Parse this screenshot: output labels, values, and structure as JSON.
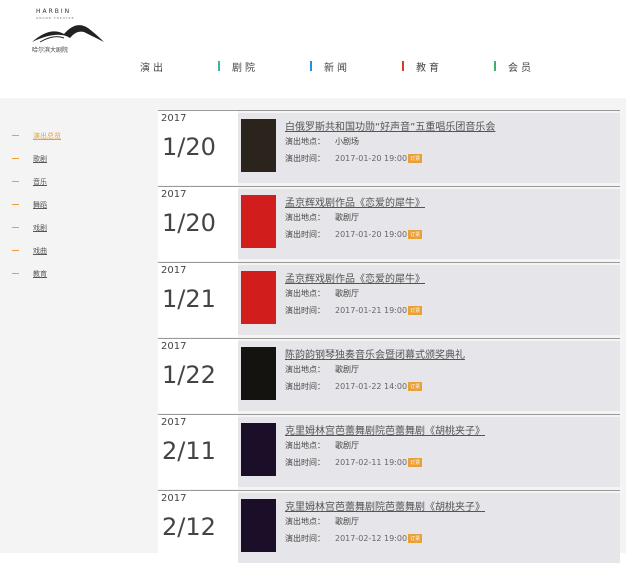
{
  "logo": {
    "brand": "HARBIN",
    "brand_sub": "GRAND THEATRE",
    "cn": "哈尔滨大剧院"
  },
  "nav": [
    {
      "label": "演出",
      "color": "#ffffff"
    },
    {
      "label": "剧院",
      "color": "#3bb3a8"
    },
    {
      "label": "新闻",
      "color": "#2b8fd6"
    },
    {
      "label": "教育",
      "color": "#d83a2b"
    },
    {
      "label": "会员",
      "color": "#3bb36a"
    }
  ],
  "sidebar": {
    "accent": "#e8a13a",
    "items": [
      {
        "label": "演出总览",
        "active": true
      },
      {
        "label": "歌剧",
        "active": false
      },
      {
        "label": "音乐",
        "active": false
      },
      {
        "label": "舞蹈",
        "active": false
      },
      {
        "label": "戏剧",
        "active": false
      },
      {
        "label": "戏曲",
        "active": false
      },
      {
        "label": "教育",
        "active": false
      }
    ]
  },
  "events": [
    {
      "year": "2017",
      "md": "1/20",
      "title": "白俄罗斯共和国功勋“好声音”五重唱乐团音乐会",
      "venue_label": "演出地点：",
      "venue": "小剧场",
      "time_label": "演出时间：",
      "time": "2017-01-20 19:00",
      "tag": "订票",
      "poster": "p-dark"
    },
    {
      "year": "2017",
      "md": "1/20",
      "title": "孟京辉戏剧作品《恋爱的犀牛》",
      "venue_label": "演出地点：",
      "venue": "歌剧厅",
      "time_label": "演出时间：",
      "time": "2017-01-20 19:00",
      "tag": "订票",
      "poster": "p-red"
    },
    {
      "year": "2017",
      "md": "1/21",
      "title": "孟京辉戏剧作品《恋爱的犀牛》",
      "venue_label": "演出地点：",
      "venue": "歌剧厅",
      "time_label": "演出时间：",
      "time": "2017-01-21 19:00",
      "tag": "订票",
      "poster": "p-red"
    },
    {
      "year": "2017",
      "md": "1/22",
      "title": "陈韵韵钢琴独奏音乐会暨闭幕式颁奖典礼",
      "venue_label": "演出地点：",
      "venue": "歌剧厅",
      "time_label": "演出时间：",
      "time": "2017-01-22 14:00",
      "tag": "订票",
      "poster": "p-black"
    },
    {
      "year": "2017",
      "md": "2/11",
      "title": "克里姆林宫芭蕾舞剧院芭蕾舞剧《胡桃夹子》",
      "venue_label": "演出地点：",
      "venue": "歌剧厅",
      "time_label": "演出时间：",
      "time": "2017-02-11 19:00",
      "tag": "订票",
      "poster": "p-purple"
    },
    {
      "year": "2017",
      "md": "2/12",
      "title": "克里姆林宫芭蕾舞剧院芭蕾舞剧《胡桃夹子》",
      "venue_label": "演出地点：",
      "venue": "歌剧厅",
      "time_label": "演出时间：",
      "time": "2017-02-12 19:00",
      "tag": "订票",
      "poster": "p-purple"
    }
  ]
}
